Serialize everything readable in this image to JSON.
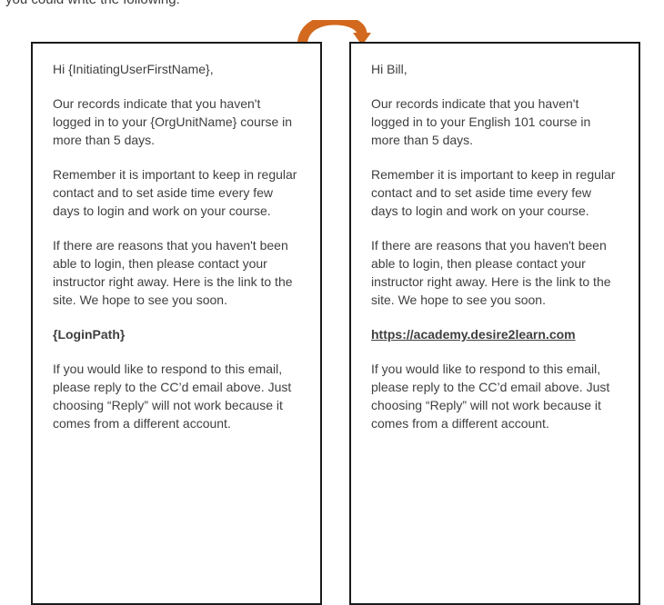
{
  "intro_text": "you could write the following:",
  "colors": {
    "arrow": "#d2691e",
    "border": "#1a1a1a",
    "text": "#3f3f3f"
  },
  "template_email": {
    "greeting": "Hi {InitiatingUserFirstName},",
    "paragraph1": "Our records indicate that you haven't logged in to your {OrgUnitName} course in more than 5 days.",
    "paragraph2": "Remember it is important to keep in regular contact and to set aside time every few days to login and work on your course.",
    "paragraph3": "If there are reasons that you haven't been able to login, then please contact your instructor right away. Here is the link to the site. We hope to see you soon.",
    "login_path": "{LoginPath}",
    "paragraph4": "If you would like to respond to this email, please reply to the CC’d email above. Just choosing “Reply” will not work because it comes from a different account."
  },
  "rendered_email": {
    "greeting": "Hi Bill,",
    "paragraph1": "Our records indicate that you haven't logged in to your English 101 course in more than 5 days.",
    "paragraph2": "Remember it is important to keep in regular contact and to set aside time every few days to login and work on your course.",
    "paragraph3": "If there are reasons that you haven't been able to login, then please contact your instructor right away. Here is the link to the site. We hope to see you soon.",
    "login_path": "https://academy.desire2learn.com",
    "paragraph4": "If you would like to respond to this email, please reply to the CC’d email above. Just choosing “Reply” will not work because it comes from a different account."
  }
}
